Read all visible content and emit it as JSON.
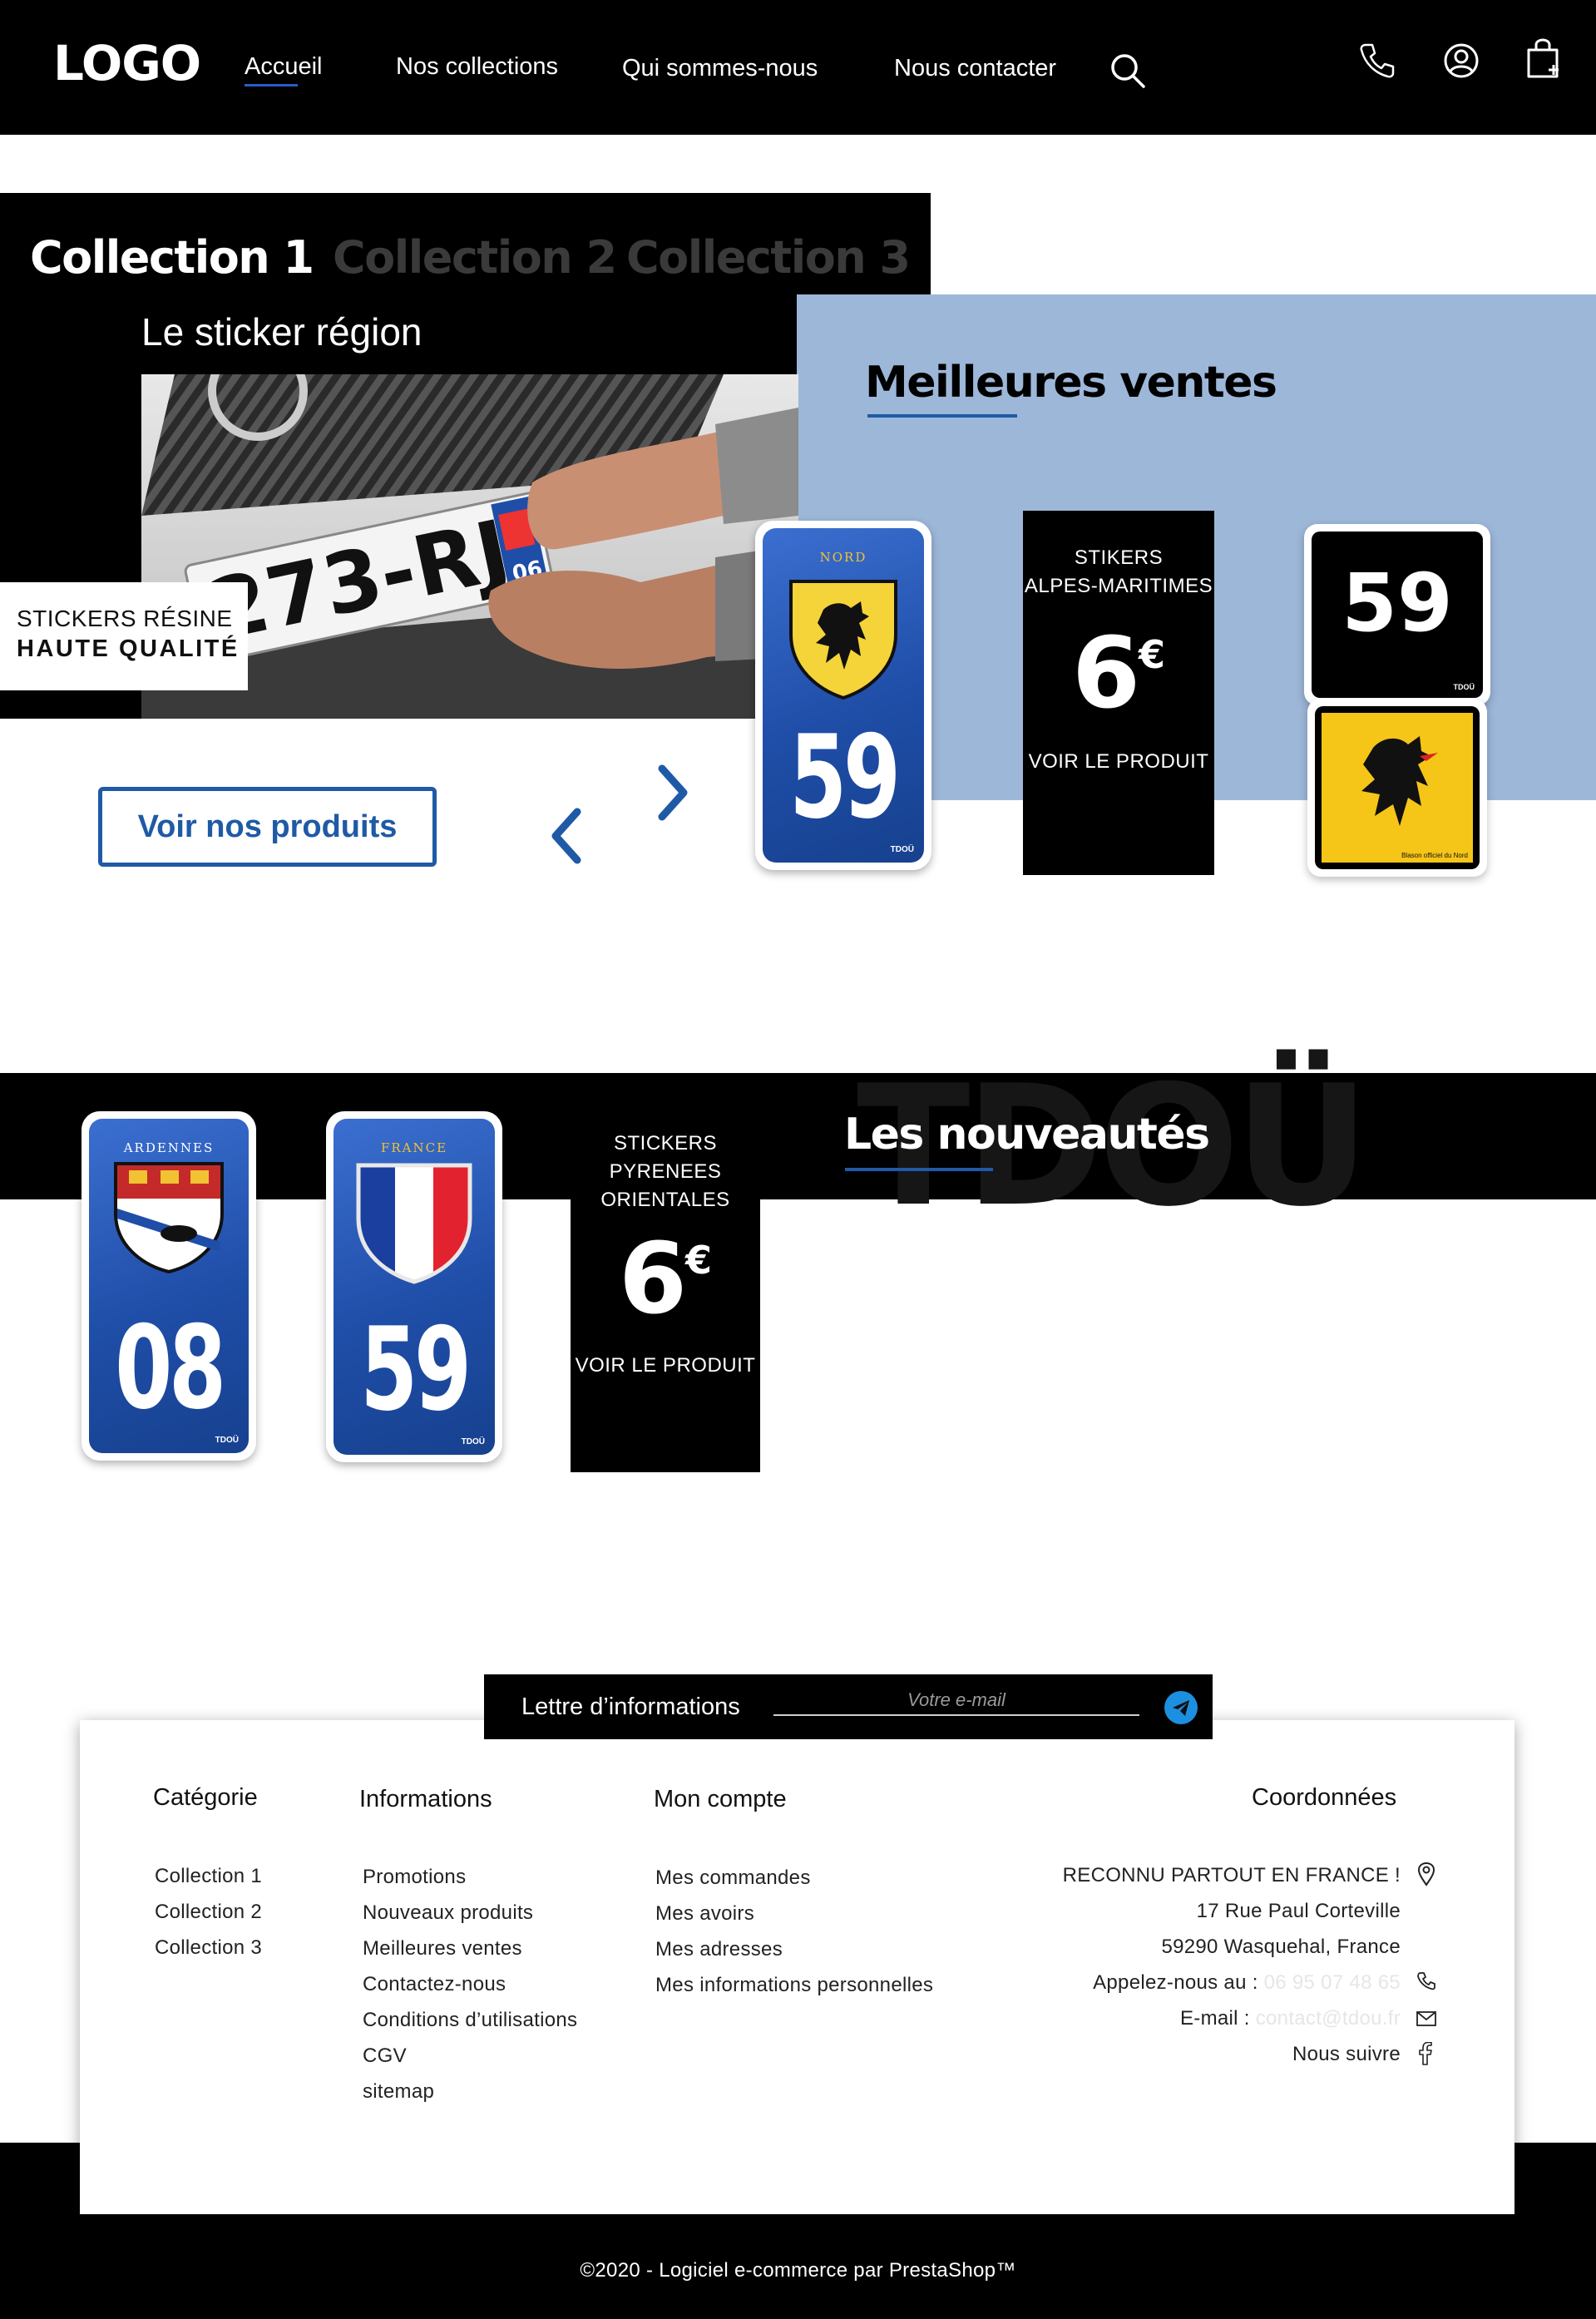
{
  "header": {
    "logo": "LOGO",
    "nav": [
      {
        "label": "Accueil"
      },
      {
        "label": "Nos collections"
      },
      {
        "label": "Qui sommes-nous"
      },
      {
        "label": "Nous contacter"
      }
    ],
    "icons": [
      "search-icon",
      "phone-icon",
      "account-icon",
      "cart-icon"
    ]
  },
  "hero": {
    "tabs": [
      {
        "label": "Collection 1",
        "active": true
      },
      {
        "label": "Collection 2",
        "active": false
      },
      {
        "label": "Collection 3",
        "active": false
      }
    ],
    "subtitle": "Le sticker région",
    "plate_text": "273-RJ",
    "plate_dept": "06",
    "badge_line1": "STICKERS RÉSINE",
    "badge_line2": "HAUTE QUALITÉ",
    "cta": "Voir nos produits"
  },
  "best_sellers": {
    "title": "Meilleures ventes",
    "plate": {
      "region": "NORD",
      "number": "59",
      "brand": "TDOÜ"
    },
    "price_card": {
      "name_line1": "STIKERS",
      "name_line2": "ALPES-MARITIMES",
      "price": "6",
      "currency": "€",
      "link": "VOIR LE PRODUIT"
    },
    "stack": {
      "number": "59",
      "brand": "TDOÜ",
      "caption": "Blason officiel du Nord"
    }
  },
  "new_products": {
    "title": "Les nouveautés",
    "watermark": "TDOÜ",
    "plates": [
      {
        "region": "ARDENNES",
        "number": "08",
        "brand": "TDOÜ"
      },
      {
        "region": "FRANCE",
        "number": "59",
        "brand": "TDOÜ"
      }
    ],
    "price_card": {
      "name_line1": "STICKERS",
      "name_line2": "PYRENEES",
      "name_line3": "ORIENTALES",
      "price": "6",
      "currency": "€",
      "link": "VOIR LE PRODUIT"
    }
  },
  "newsletter": {
    "label": "Lettre d’informations",
    "placeholder": "Votre e-mail"
  },
  "footer": {
    "categorie": {
      "title": "Catégorie",
      "links": [
        "Collection 1",
        "Collection 2",
        "Collection 3"
      ]
    },
    "informations": {
      "title": "Informations",
      "links": [
        "Promotions",
        "Nouveaux produits",
        "Meilleures ventes",
        "Contactez-nous",
        "Conditions d’utilisations",
        "CGV",
        "sitemap"
      ]
    },
    "compte": {
      "title": "Mon compte",
      "links": [
        "Mes commandes",
        "Mes avoirs",
        "Mes adresses",
        "Mes informations personnelles"
      ]
    },
    "coordonnees": {
      "title": "Coordonnées",
      "line1": "RECONNU PARTOUT EN FRANCE !",
      "line2": "17 Rue Paul Corteville",
      "line3": "59290 Wasquehal, France",
      "phone_label": "Appelez-nous au : ",
      "phone": "06 95 07 48 65",
      "email_label": "E-mail : ",
      "email": "contact@tdou.fr",
      "follow": "Nous suivre"
    },
    "copyright": "©2020 - Logiciel e-commerce par PrestaShop™"
  },
  "colors": {
    "accent": "#1f5aa6",
    "best_sellers_bg": "#9db7d9",
    "black": "#000000",
    "flag_yellow": "#f5c518"
  }
}
